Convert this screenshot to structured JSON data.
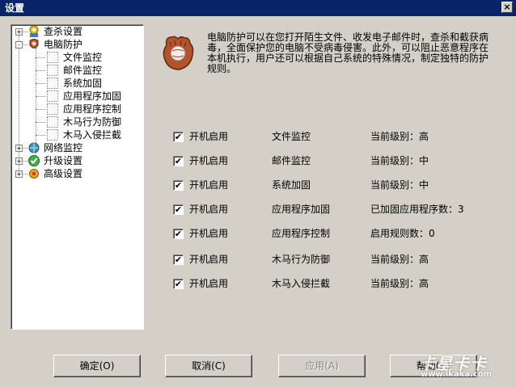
{
  "window": {
    "title": "设置"
  },
  "tree": {
    "items": [
      {
        "label": "查杀设置",
        "expander": "+",
        "icon": "scan-shield-icon"
      },
      {
        "label": "电脑防护",
        "expander": "-",
        "icon": "glove-shield-icon",
        "children": [
          "文件监控",
          "邮件监控",
          "系统加固",
          "应用程序加固",
          "应用程序控制",
          "木马行为防御",
          "木马入侵拦截"
        ]
      },
      {
        "label": "网络监控",
        "expander": "+",
        "icon": "network-globe-icon"
      },
      {
        "label": "升级设置",
        "expander": "+",
        "icon": "upgrade-check-icon"
      },
      {
        "label": "高级设置",
        "expander": "+",
        "icon": "advanced-gear-icon"
      }
    ]
  },
  "description": "电脑防护可以在您打开陌生文件、收发电子邮件时，查杀和截获病毒，全面保护您的电脑不受病毒侵害。此外，可以阻止恶意程序在本机执行，用户还可以根据自己系统的特殊情况，制定独特的防护规则。",
  "rows": [
    {
      "checked": true,
      "enable_label": "开机启用",
      "name": "文件监控",
      "level": "当前级别：高"
    },
    {
      "checked": true,
      "enable_label": "开机启用",
      "name": "邮件监控",
      "level": "当前级别：中"
    },
    {
      "checked": true,
      "enable_label": "开机启用",
      "name": "系统加固",
      "level": "当前级别：中"
    },
    {
      "checked": true,
      "enable_label": "开机启用",
      "name": "应用程序加固",
      "level": "已加固应用程序数：3"
    },
    {
      "checked": true,
      "enable_label": "开机启用",
      "name": "应用程序控制",
      "level": "启用规则数：0"
    },
    {
      "checked": true,
      "enable_label": "开机启用",
      "name": "木马行为防御",
      "level": "当前级别：高"
    },
    {
      "checked": true,
      "enable_label": "开机启用",
      "name": "木马入侵拦截",
      "level": "当前级别：高"
    }
  ],
  "buttons": {
    "ok": "确定(O)",
    "cancel": "取消(C)",
    "apply": "应用(A)",
    "help": "帮助(H)"
  },
  "watermark": {
    "text": "卡星卡卡",
    "url": "www.ikaka.com"
  },
  "colors": {
    "titlebar": "#0a246a",
    "face": "#d4d0c8",
    "glove": "#b5532b"
  }
}
